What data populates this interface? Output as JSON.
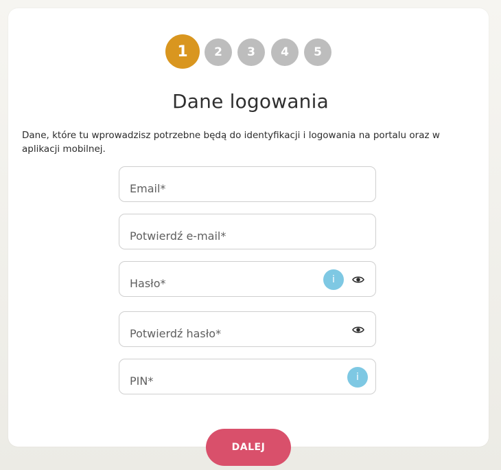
{
  "colors": {
    "step_active": "#d9961f",
    "step_inactive": "#bdbdbd",
    "info": "#7ec8e3",
    "primary_button": "#d9506b"
  },
  "steps": [
    {
      "label": "1",
      "active": true
    },
    {
      "label": "2",
      "active": false
    },
    {
      "label": "3",
      "active": false
    },
    {
      "label": "4",
      "active": false
    },
    {
      "label": "5",
      "active": false
    }
  ],
  "form": {
    "title": "Dane logowania",
    "description": "Dane, które tu wprowadzisz potrzebne będą do identyfikacji i logowania na portalu oraz w aplikacji mobilnej.",
    "fields": {
      "email": {
        "placeholder": "Email*",
        "value": ""
      },
      "confirm_email": {
        "placeholder": "Potwierdź e-mail*",
        "value": ""
      },
      "password": {
        "placeholder": "Hasło*",
        "value": ""
      },
      "confirm_password": {
        "placeholder": "Potwierdź hasło*",
        "value": ""
      },
      "pin": {
        "placeholder": "PIN*",
        "value": ""
      }
    },
    "info_icon_glyph": "i",
    "icons": {
      "info": "info-icon",
      "visibility": "eye-icon"
    },
    "next_label": "DALEJ"
  }
}
